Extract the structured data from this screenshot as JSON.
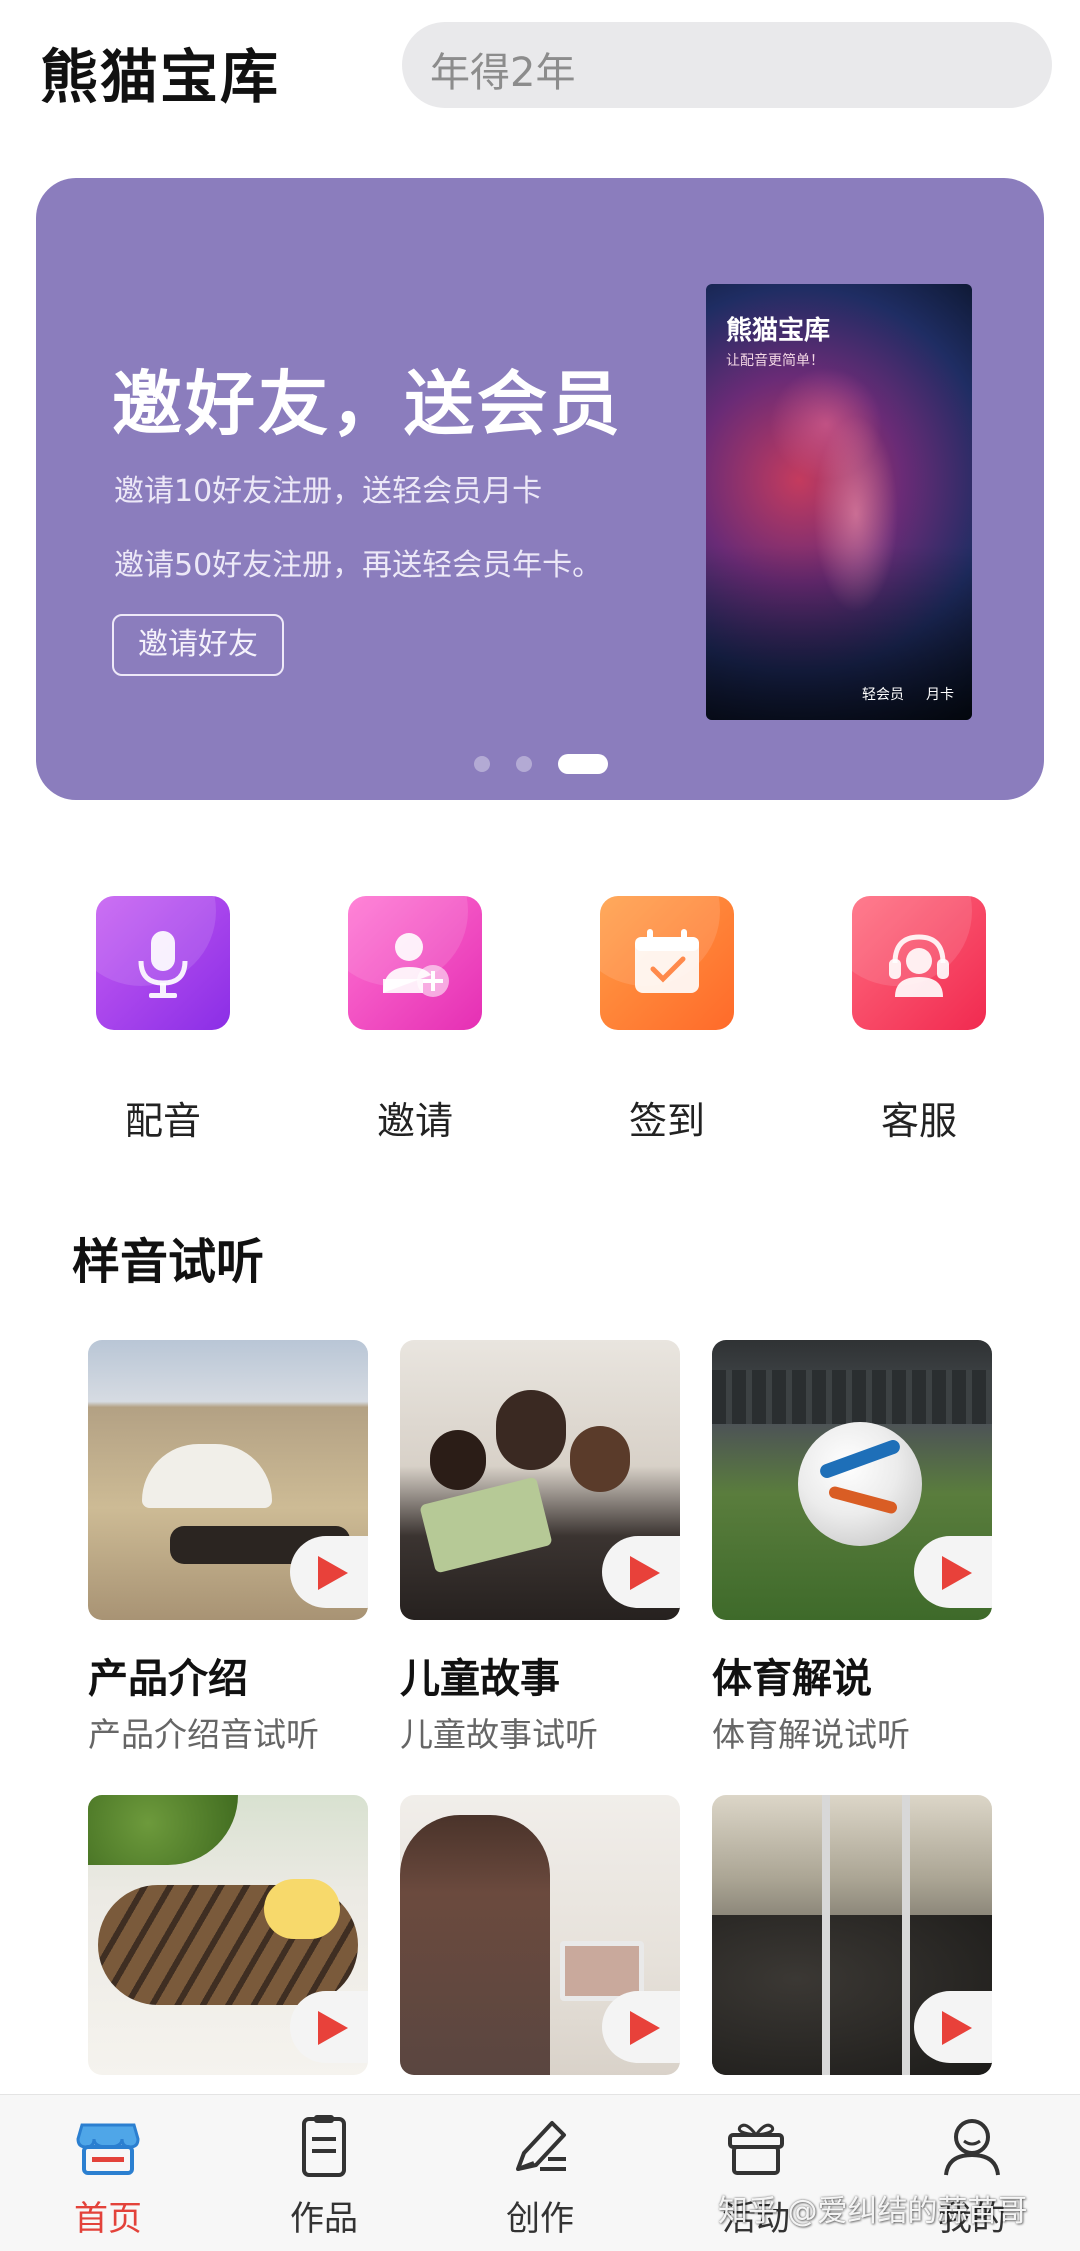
{
  "header": {
    "app_title": "熊猫宝库",
    "search_text": "年得2年"
  },
  "banner": {
    "title": "邀好友，送会员",
    "line1": "邀请10好友注册，送轻会员月卡",
    "line2": "邀请50好友注册，再送轻会员年卡。",
    "button_label": "邀请好友",
    "poster": {
      "title": "熊猫宝库",
      "subtitle": "让配音更简单！",
      "footer_left": "轻会员",
      "footer_right": "月卡"
    },
    "pagination": {
      "count": 3,
      "active_index": 2
    },
    "color": "#8b7dbd"
  },
  "actions": [
    {
      "label": "配音",
      "icon": "microphone-icon",
      "color": "#a443ee"
    },
    {
      "label": "邀请",
      "icon": "add-user-icon",
      "color": "#f04ac4"
    },
    {
      "label": "签到",
      "icon": "calendar-check-icon",
      "color": "#ff7a34"
    },
    {
      "label": "客服",
      "icon": "headset-icon",
      "color": "#f53b5d"
    }
  ],
  "section": {
    "title": "样音试听"
  },
  "samples": [
    {
      "title": "产品介绍",
      "subtitle": "产品介绍音试听"
    },
    {
      "title": "儿童故事",
      "subtitle": "儿童故事试听"
    },
    {
      "title": "体育解说",
      "subtitle": "体育解说试听"
    },
    {
      "title": "",
      "subtitle": ""
    },
    {
      "title": "",
      "subtitle": ""
    },
    {
      "title": "",
      "subtitle": ""
    }
  ],
  "bottom_nav": {
    "items": [
      {
        "label": "首页",
        "icon": "store-icon",
        "active": true
      },
      {
        "label": "作品",
        "icon": "document-icon",
        "active": false
      },
      {
        "label": "创作",
        "icon": "pen-icon",
        "active": false
      },
      {
        "label": "活动",
        "icon": "gift-icon",
        "active": false
      },
      {
        "label": "我的",
        "icon": "user-icon",
        "active": false
      }
    ],
    "active_color": "#e3423a"
  },
  "watermark": "知乎 @爱纠结的蒜苗哥"
}
